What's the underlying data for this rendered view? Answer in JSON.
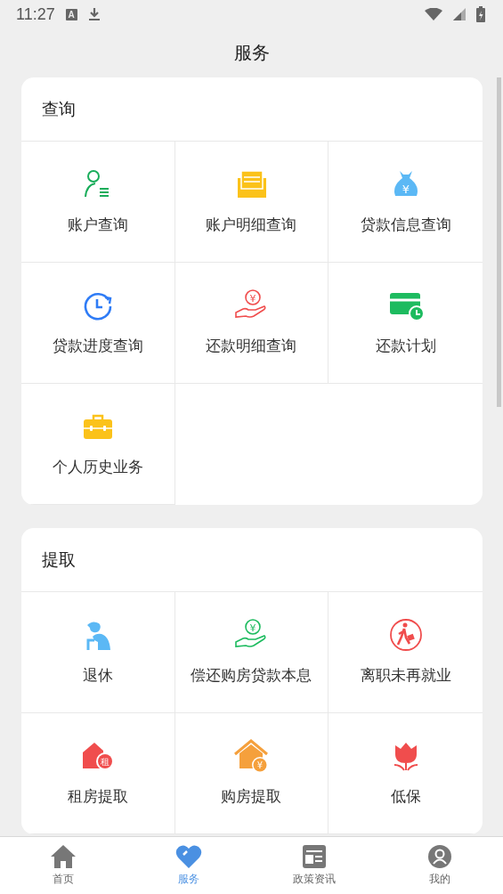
{
  "status_bar": {
    "time": "11:27",
    "app_badge": "A"
  },
  "title": "服务",
  "sections": [
    {
      "title": "查询",
      "items": [
        {
          "label": "账户查询"
        },
        {
          "label": "账户明细查询"
        },
        {
          "label": "贷款信息查询",
          "icon_text": "¥"
        },
        {
          "label": "贷款进度查询"
        },
        {
          "label": "还款明细查询",
          "icon_text": "¥"
        },
        {
          "label": "还款计划"
        },
        {
          "label": "个人历史业务"
        }
      ]
    },
    {
      "title": "提取",
      "items": [
        {
          "label": "退休"
        },
        {
          "label": "偿还购房贷款本息",
          "icon_text": "¥"
        },
        {
          "label": "离职未再就业"
        },
        {
          "label": "租房提取",
          "icon_text": "租"
        },
        {
          "label": "购房提取",
          "icon_text": "¥"
        },
        {
          "label": "低保"
        }
      ]
    }
  ],
  "nav": [
    {
      "label": "首页",
      "selected": false
    },
    {
      "label": "服务",
      "selected": true
    },
    {
      "label": "政策资讯",
      "selected": false
    },
    {
      "label": "我的",
      "selected": false
    }
  ]
}
